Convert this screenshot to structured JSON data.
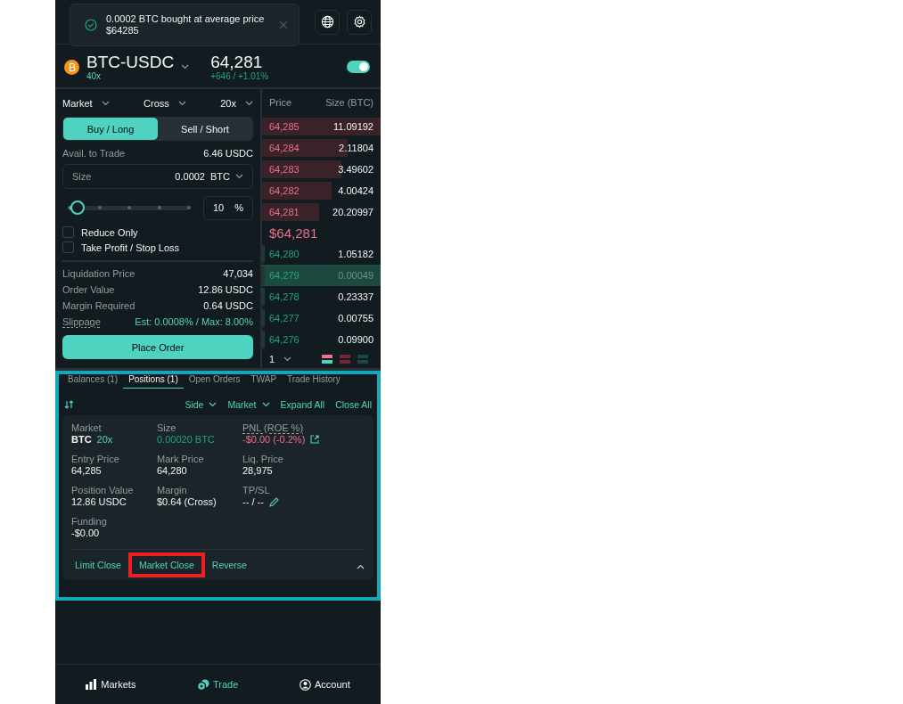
{
  "toast": {
    "message": "0.0002 BTC bought at average price $64285"
  },
  "market": {
    "symbol": "BTC-USDC",
    "leverage": "40x",
    "price": "64,281",
    "change": "+646 / +1.01%",
    "toggle_on": true
  },
  "order_form": {
    "selectors": [
      "Market",
      "Cross",
      "20x"
    ],
    "sides": [
      {
        "label": "Buy / Long",
        "selected": true
      },
      {
        "label": "Sell / Short",
        "selected": false
      }
    ],
    "available": {
      "label": "Avail. to Trade",
      "value": "6.46 USDC"
    },
    "size": {
      "label": "Size",
      "value": "0.0002",
      "unit": "BTC"
    },
    "slider": {
      "level": 0.07
    },
    "percent": {
      "value": "10",
      "unit": "%"
    },
    "options": [
      {
        "label": "Reduce Only",
        "checked": false
      },
      {
        "label": "Take Profit / Stop Loss",
        "checked": false
      }
    ],
    "summary": [
      {
        "label": "Liquidation Price",
        "value": "47,034",
        "kind": "plain"
      },
      {
        "label": "Order Value",
        "value": "12.86 USDC",
        "kind": "plain"
      },
      {
        "label": "Margin Required",
        "value": "0.64 USDC",
        "kind": "plain"
      },
      {
        "label": "Slippage",
        "value": "Est: 0.0008% / Max: 8.00%",
        "kind": "accent"
      }
    ],
    "submit": "Place Order"
  },
  "order_book": {
    "columns": [
      "Price",
      "Size (BTC)"
    ],
    "asks": [
      {
        "price": "64,285",
        "size": "11.09192",
        "level": 1.0
      },
      {
        "price": "64,284",
        "size": "2.11804",
        "level": 0.72
      },
      {
        "price": "64,283",
        "size": "3.49602",
        "level": 0.67
      },
      {
        "price": "64,282",
        "size": "4.00424",
        "level": 0.59
      },
      {
        "price": "64,281",
        "size": "20.20997",
        "level": 0.48
      }
    ],
    "mid_price": "$64,281",
    "bids": [
      {
        "price": "64,280",
        "size": "1.05182",
        "level": 0.02,
        "selected": false
      },
      {
        "price": "64,279",
        "size": "0.00049",
        "level": 0.02,
        "selected": true
      },
      {
        "price": "64,278",
        "size": "0.23337",
        "level": 0.02,
        "selected": false
      },
      {
        "price": "64,277",
        "size": "0.00755",
        "level": 0.02,
        "selected": false
      },
      {
        "price": "64,276",
        "size": "0.09900",
        "level": 0.02,
        "selected": false
      }
    ],
    "group": "1"
  },
  "positions": {
    "tabs": [
      {
        "label": "Balances (1)",
        "selected": false
      },
      {
        "label": "Positions (1)",
        "selected": true
      },
      {
        "label": "Open Orders",
        "selected": false
      },
      {
        "label": "TWAP",
        "selected": false
      },
      {
        "label": "Trade History",
        "selected": false
      }
    ],
    "filters": [
      "Side",
      "Market"
    ],
    "actions": [
      "Expand All",
      "Close All"
    ],
    "fields": [
      {
        "label": "Market",
        "value": "BTC",
        "tag": "20x",
        "kind": "market"
      },
      {
        "label": "Size",
        "value": "0.00020 BTC",
        "kind": "positive"
      },
      {
        "label": "PNL (ROE %)",
        "value": "-$0.00 (-0.2%)",
        "kind": "pnl"
      },
      {
        "label": "Entry Price",
        "value": "64,285",
        "kind": "plain"
      },
      {
        "label": "Mark Price",
        "value": "64,280",
        "kind": "plain"
      },
      {
        "label": "Liq. Price",
        "value": "28,975",
        "kind": "plain"
      },
      {
        "label": "Position Value",
        "value": "12.86 USDC",
        "kind": "plain"
      },
      {
        "label": "Margin",
        "value": "$0.64 (Cross)",
        "kind": "plain"
      },
      {
        "label": "TP/SL",
        "value": "-- / --",
        "kind": "editable"
      },
      {
        "label": "Funding",
        "value": "-$0.00",
        "kind": "plain"
      }
    ],
    "card_actions": [
      {
        "label": "Limit Close",
        "highlighted": false
      },
      {
        "label": "Market Close",
        "highlighted": true
      },
      {
        "label": "Reverse",
        "highlighted": false
      }
    ],
    "expanded": true
  },
  "nav": [
    {
      "label": "Markets",
      "selected": false
    },
    {
      "label": "Trade",
      "selected": true
    },
    {
      "label": "Account",
      "selected": false
    }
  ]
}
